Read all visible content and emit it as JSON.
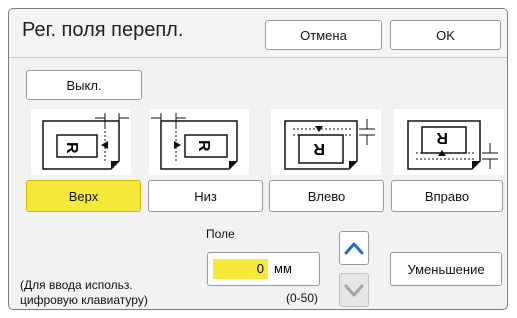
{
  "dialog": {
    "title": "Рег. поля перепл.",
    "cancel_label": "Отмена",
    "ok_label": "OK",
    "off_label": "Выкл."
  },
  "positions": [
    {
      "label": "Верх",
      "selected": true,
      "icon": "binding-top-icon"
    },
    {
      "label": "Низ",
      "selected": false,
      "icon": "binding-bottom-icon"
    },
    {
      "label": "Влево",
      "selected": false,
      "icon": "binding-left-icon"
    },
    {
      "label": "Вправо",
      "selected": false,
      "icon": "binding-right-icon"
    }
  ],
  "margin": {
    "label": "Поле",
    "value": "0",
    "unit": "мм",
    "range": "(0-50)",
    "hint_line1": "(Для ввода использ.",
    "hint_line2": "цифровую клавиатуру)",
    "up_icon": "chevron-up-icon",
    "down_icon": "chevron-down-icon",
    "decrease_label": "Уменьшение"
  },
  "colors": {
    "selected": "#f7e93c",
    "accent": "#1f6fc8"
  }
}
